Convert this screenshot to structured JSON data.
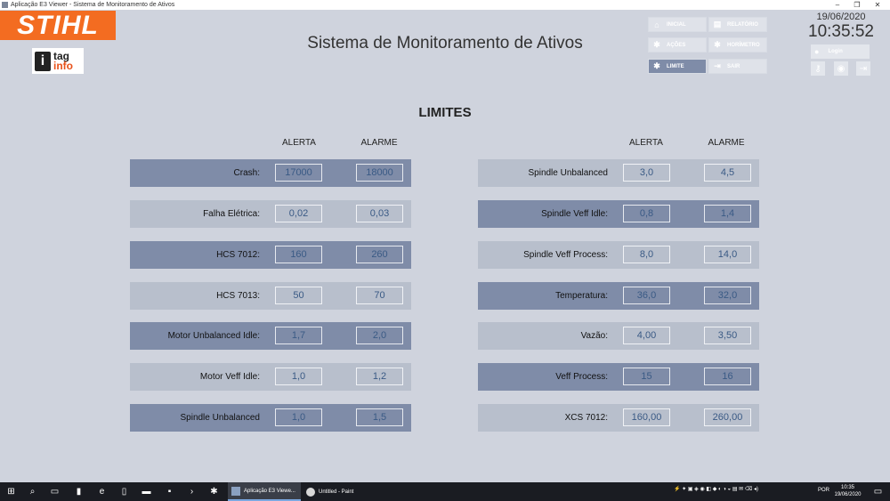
{
  "window": {
    "title": "Aplicação E3 Viewer - Sistema de Monitoramento de Ativos"
  },
  "brand": {
    "logo_text": "STIHL",
    "logo_color": "#f36c21",
    "partner_letter": "i",
    "partner_tag": "tag",
    "partner_info": "info"
  },
  "header": {
    "title": "Sistema de Monitoramento de Ativos",
    "date": "19/06/2020",
    "time": "10:35:52",
    "login_label": "Login"
  },
  "nav": [
    {
      "label": "INICIAL",
      "icon": "home-icon",
      "active": false
    },
    {
      "label": "RELATÓRIO",
      "icon": "report-icon",
      "active": false
    },
    {
      "label": "AÇÕES",
      "icon": "gear-icon",
      "active": false
    },
    {
      "label": "HORÍMETRO",
      "icon": "gear-icon",
      "active": false
    },
    {
      "label": "LIMITE",
      "icon": "gear-icon",
      "active": true
    },
    {
      "label": "SAIR",
      "icon": "exit-icon",
      "active": false
    }
  ],
  "page": {
    "title": "LIMITES",
    "col_alerta": "ALERTA",
    "col_alarme": "ALARME"
  },
  "left_rows": [
    {
      "label": "Crash:",
      "alerta": "17000",
      "alarme": "18000"
    },
    {
      "label": "Falha Elétrica:",
      "alerta": "0,02",
      "alarme": "0,03"
    },
    {
      "label": "HCS 7012:",
      "alerta": "160",
      "alarme": "260"
    },
    {
      "label": "HCS 7013:",
      "alerta": "50",
      "alarme": "70"
    },
    {
      "label": "Motor Unbalanced Idle:",
      "alerta": "1,7",
      "alarme": "2,0"
    },
    {
      "label": "Motor Veff Idle:",
      "alerta": "1,0",
      "alarme": "1,2"
    },
    {
      "label": "Spindle Unbalanced",
      "alerta": "1,0",
      "alarme": "1,5"
    }
  ],
  "right_rows": [
    {
      "label": "Spindle Unbalanced",
      "alerta": "3,0",
      "alarme": "4,5"
    },
    {
      "label": "Spindle Veff Idle:",
      "alerta": "0,8",
      "alarme": "1,4"
    },
    {
      "label": "Spindle Veff Process:",
      "alerta": "8,0",
      "alarme": "14,0"
    },
    {
      "label": "Temperatura:",
      "alerta": "36,0",
      "alarme": "32,0"
    },
    {
      "label": "Vazão:",
      "alerta": "4,00",
      "alarme": "3,50"
    },
    {
      "label": "Veff Process:",
      "alerta": "15",
      "alarme": "16"
    },
    {
      "label": "XCS 7012:",
      "alerta": "160,00",
      "alarme": "260,00"
    }
  ],
  "taskbar": {
    "apps": [
      {
        "label": "Aplicação E3 Viewe...",
        "active": true
      },
      {
        "label": "Untitled - Paint",
        "active": false
      }
    ],
    "lang": "POR",
    "clock_time": "10:35",
    "clock_date": "19/06/2020"
  },
  "colors": {
    "background": "#cfd3dd",
    "row_dark": "#7f8ca8",
    "row_light": "#b8bfcc",
    "value_text": "#3a5a85"
  }
}
